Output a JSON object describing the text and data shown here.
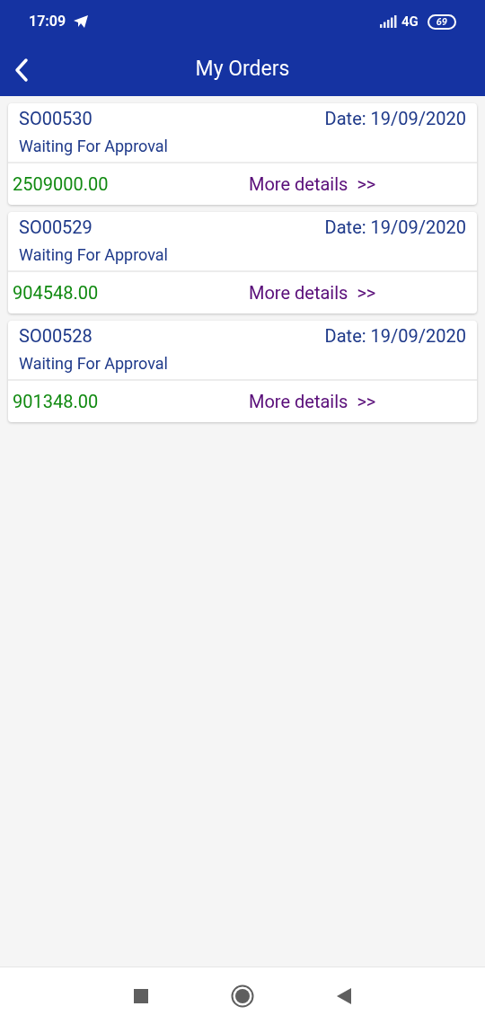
{
  "status_bar": {
    "time": "17:09",
    "network": "4G",
    "battery": "69"
  },
  "header": {
    "title": "My Orders"
  },
  "orders": [
    {
      "number": "SO00530",
      "date": "Date: 19/09/2020",
      "status": "Waiting For Approval",
      "amount": "2509000.00",
      "link": "More details",
      "link_arrow": ">>"
    },
    {
      "number": "SO00529",
      "date": "Date: 19/09/2020",
      "status": "Waiting For Approval",
      "amount": "904548.00",
      "link": "More details",
      "link_arrow": ">>"
    },
    {
      "number": "SO00528",
      "date": "Date: 19/09/2020",
      "status": "Waiting For Approval",
      "amount": "901348.00",
      "link": "More details",
      "link_arrow": ">>"
    }
  ]
}
